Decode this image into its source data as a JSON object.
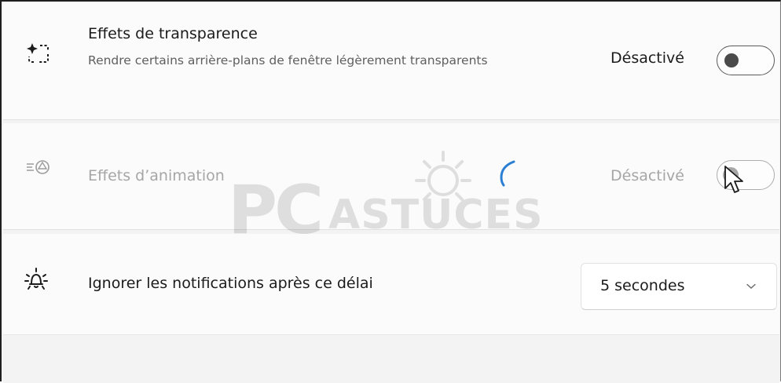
{
  "settings": {
    "transparency": {
      "title": "Effets de transparence",
      "description": "Rendre certains arrière-plans de fenêtre légèrement transparents",
      "state_label": "Désactivé",
      "enabled": false,
      "icon": "transparency-icon"
    },
    "animation": {
      "title": "Effets d’animation",
      "state_label": "Désactivé",
      "enabled": false,
      "icon": "animation-icon"
    },
    "notifications": {
      "title": "Ignorer les notifications après ce délai",
      "selected": "5 secondes",
      "icon": "notification-brightness-icon"
    }
  },
  "watermark": {
    "brand_a": "PC",
    "brand_b": "ASTUCES"
  },
  "colors": {
    "spinner": "#2a7fd4",
    "card": "#fbfbfb",
    "background": "#f3f3f3"
  }
}
